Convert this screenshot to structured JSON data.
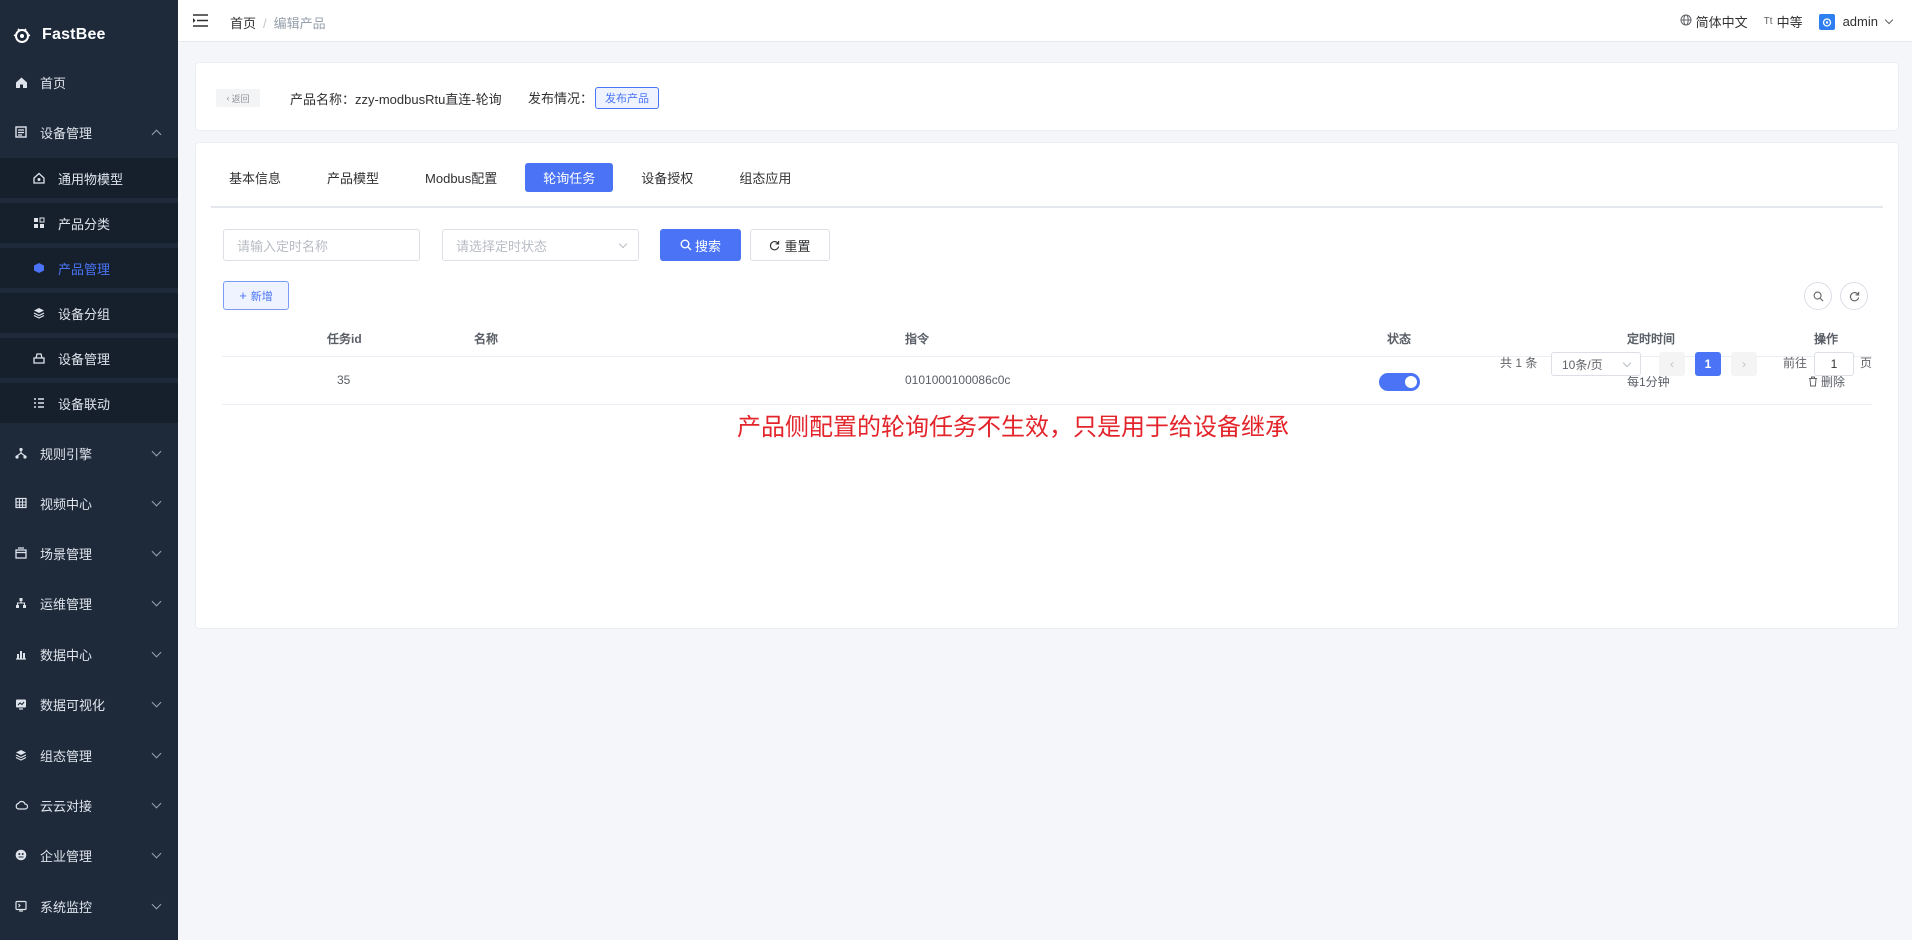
{
  "app": {
    "name": "FastBee"
  },
  "sidebar": {
    "items": [
      {
        "label": "首页",
        "icon": "home-icon",
        "expandable": false
      },
      {
        "label": "设备管理",
        "icon": "device-icon",
        "expandable": true,
        "expanded": true,
        "children": [
          {
            "label": "通用物模型",
            "icon": "model-icon",
            "active": false
          },
          {
            "label": "产品分类",
            "icon": "category-icon",
            "active": false
          },
          {
            "label": "产品管理",
            "icon": "product-icon",
            "active": true
          },
          {
            "label": "设备分组",
            "icon": "group-icon",
            "active": false
          },
          {
            "label": "设备管理",
            "icon": "device-manage-icon",
            "active": false
          },
          {
            "label": "设备联动",
            "icon": "linkage-icon",
            "active": false
          }
        ]
      },
      {
        "label": "规则引擎",
        "icon": "rule-icon",
        "expandable": true
      },
      {
        "label": "视频中心",
        "icon": "video-icon",
        "expandable": true
      },
      {
        "label": "场景管理",
        "icon": "scene-icon",
        "expandable": true
      },
      {
        "label": "运维管理",
        "icon": "ops-icon",
        "expandable": true
      },
      {
        "label": "数据中心",
        "icon": "data-icon",
        "expandable": true
      },
      {
        "label": "数据可视化",
        "icon": "visual-icon",
        "expandable": true
      },
      {
        "label": "组态管理",
        "icon": "scada-icon",
        "expandable": true
      },
      {
        "label": "云云对接",
        "icon": "cloud-icon",
        "expandable": true
      },
      {
        "label": "企业管理",
        "icon": "enterprise-icon",
        "expandable": true
      },
      {
        "label": "系统监控",
        "icon": "monitor-icon",
        "expandable": true
      }
    ]
  },
  "header": {
    "breadcrumb": [
      "首页",
      "编辑产品"
    ],
    "breadcrumb_sep": "/",
    "language": "简体中文",
    "size": "中等",
    "size_icon_text": "Tt",
    "user": "admin"
  },
  "product": {
    "back_label": "返回",
    "name_line": "产品名称：zzy-modbusRtu直连-轮询",
    "publish_label": "发布情况：",
    "publish_button": "发布产品"
  },
  "tabs": [
    {
      "label": "基本信息",
      "active": false
    },
    {
      "label": "产品模型",
      "active": false
    },
    {
      "label": "Modbus配置",
      "active": false
    },
    {
      "label": "轮询任务",
      "active": true
    },
    {
      "label": "设备授权",
      "active": false
    },
    {
      "label": "组态应用",
      "active": false
    }
  ],
  "filters": {
    "name_placeholder": "请输入定时名称",
    "status_placeholder": "请选择定时状态",
    "search_label": "搜索",
    "reset_label": "重置",
    "add_label": "新增"
  },
  "table": {
    "columns": [
      "任务id",
      "名称",
      "指令",
      "状态",
      "定时时间",
      "操作"
    ],
    "rows": [
      {
        "id": "35",
        "name": "",
        "command": "0101000100086c0c",
        "status": true,
        "schedule": "每1分钟",
        "action": "删除"
      }
    ]
  },
  "annotation": "产品侧配置的轮询任务不生效，只是用于给设备继承",
  "pagination": {
    "total": "共 1 条",
    "page_size": "10条/页",
    "current_page": "1",
    "goto_label": "前往",
    "goto_value": "1",
    "page_suffix": "页"
  },
  "colors": {
    "primary": "#4a74f5",
    "sidebar": "#1e2a3a",
    "annotation": "#e3242b"
  }
}
